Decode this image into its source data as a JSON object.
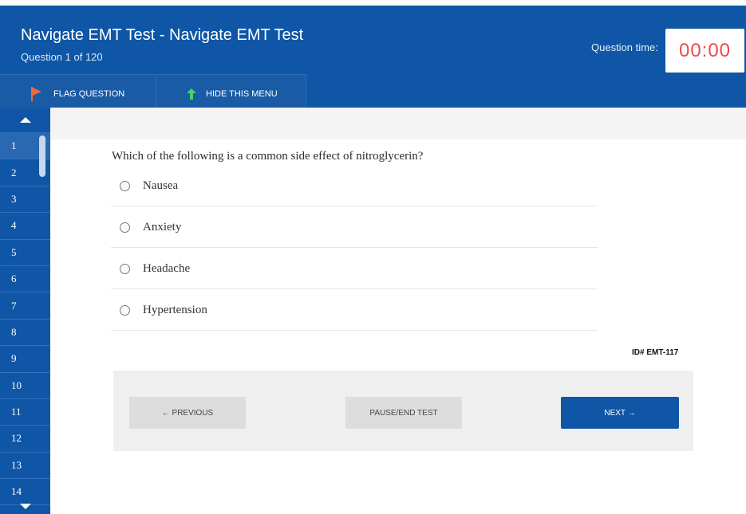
{
  "header": {
    "title": "Navigate EMT Test - Navigate EMT Test",
    "subtitle": "Question 1 of 120",
    "timer_label": "Question time:",
    "timer_value": "00:00"
  },
  "toolbar": {
    "flag_label": "FLAG QUESTION",
    "hide_menu_label": "HIDE THIS MENU"
  },
  "sidebar": {
    "question_numbers": [
      "1",
      "2",
      "3",
      "4",
      "5",
      "6",
      "7",
      "8",
      "9",
      "10",
      "11",
      "12",
      "13",
      "14"
    ],
    "active_question": "1"
  },
  "question": {
    "text": "Which of the following is a common side effect of nitroglycerin?",
    "options": [
      "Nausea",
      "Anxiety",
      "Headache",
      "Hypertension"
    ],
    "id": "ID# EMT-117"
  },
  "navigation": {
    "previous_label": "← PREVIOUS",
    "pause_label": "PAUSE/END TEST",
    "next_label": "NEXT →"
  },
  "colors": {
    "primary_blue": "#0f56a6",
    "timer_red": "#ec4a4a",
    "flag_orange": "#f06a3b",
    "arrow_green": "#47d16b"
  },
  "icons": [
    "flag-icon",
    "up-arrow-icon",
    "scroll-up-icon",
    "scroll-down-icon",
    "radio-icon"
  ]
}
